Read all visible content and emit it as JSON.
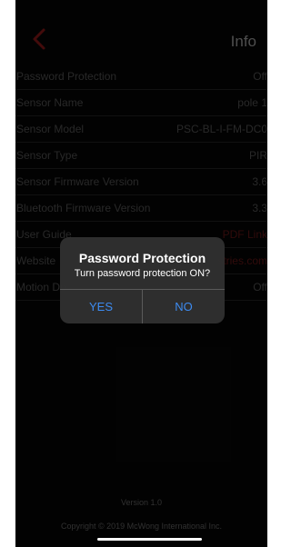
{
  "header": {
    "title": "Info",
    "back_icon": "chevron-left-icon",
    "accent_color": "#8b1a1a"
  },
  "rows": [
    {
      "label": "Password Protection",
      "value": "Off"
    },
    {
      "label": "Sensor Name",
      "value": "pole 1"
    },
    {
      "label": "Sensor Model",
      "value": "PSC-BL-I-FM-DC0"
    },
    {
      "label": "Sensor Type",
      "value": "PIR"
    },
    {
      "label": "Sensor Firmware Version",
      "value": "3.6"
    },
    {
      "label": "Bluetooth Firmware Version",
      "value": "3.3"
    },
    {
      "label": "User Guide",
      "value": "PDF Link"
    },
    {
      "label": "Website",
      "value": "stries.com"
    },
    {
      "label": "Motion De",
      "value": "Off"
    }
  ],
  "dialog": {
    "title": "Password Protection",
    "message": "Turn password protection ON?",
    "yes_label": "YES",
    "no_label": "NO",
    "button_color": "#3d8bf0"
  },
  "footer": {
    "version": "Version 1.0",
    "copyright": "Copyright © 2019 McWong International Inc."
  }
}
